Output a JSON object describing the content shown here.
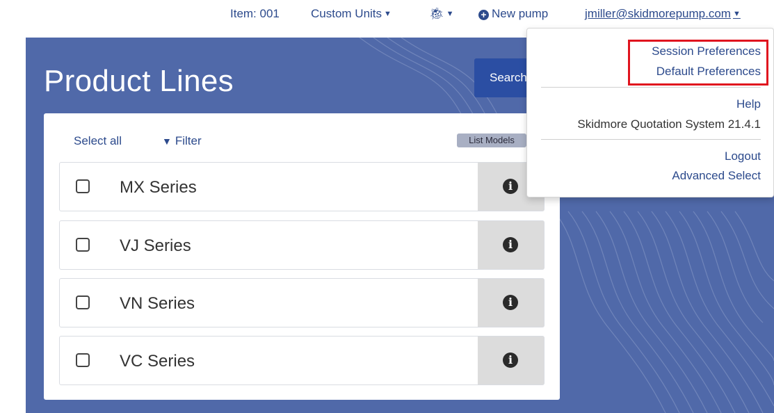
{
  "topnav": {
    "item": "Item: 001",
    "custom_units": "Custom Units",
    "bug_icon": "bug-icon",
    "new_pump": "New pump",
    "email": "jmiller@skidmorepump.com",
    "caret": "▾"
  },
  "hero": {
    "title": "Product Lines",
    "search_label": "Search",
    "bg_color": "#5069a9"
  },
  "panel": {
    "select_all": "Select all",
    "filter": "Filter",
    "list_models": "List Models",
    "rows": [
      {
        "label": "MX Series",
        "checked": false
      },
      {
        "label": "VJ Series",
        "checked": false
      },
      {
        "label": "VN Series",
        "checked": false
      },
      {
        "label": "VC Series",
        "checked": false
      }
    ]
  },
  "dropdown": {
    "session_preferences": "Session Preferences",
    "default_preferences": "Default Preferences",
    "help": "Help",
    "version": "Skidmore Quotation System 21.4.1",
    "logout": "Logout",
    "advanced_select": "Advanced Select"
  },
  "colors": {
    "link": "#2c4a8c",
    "highlight": "#e0141e",
    "button": "#2b4ea3"
  }
}
